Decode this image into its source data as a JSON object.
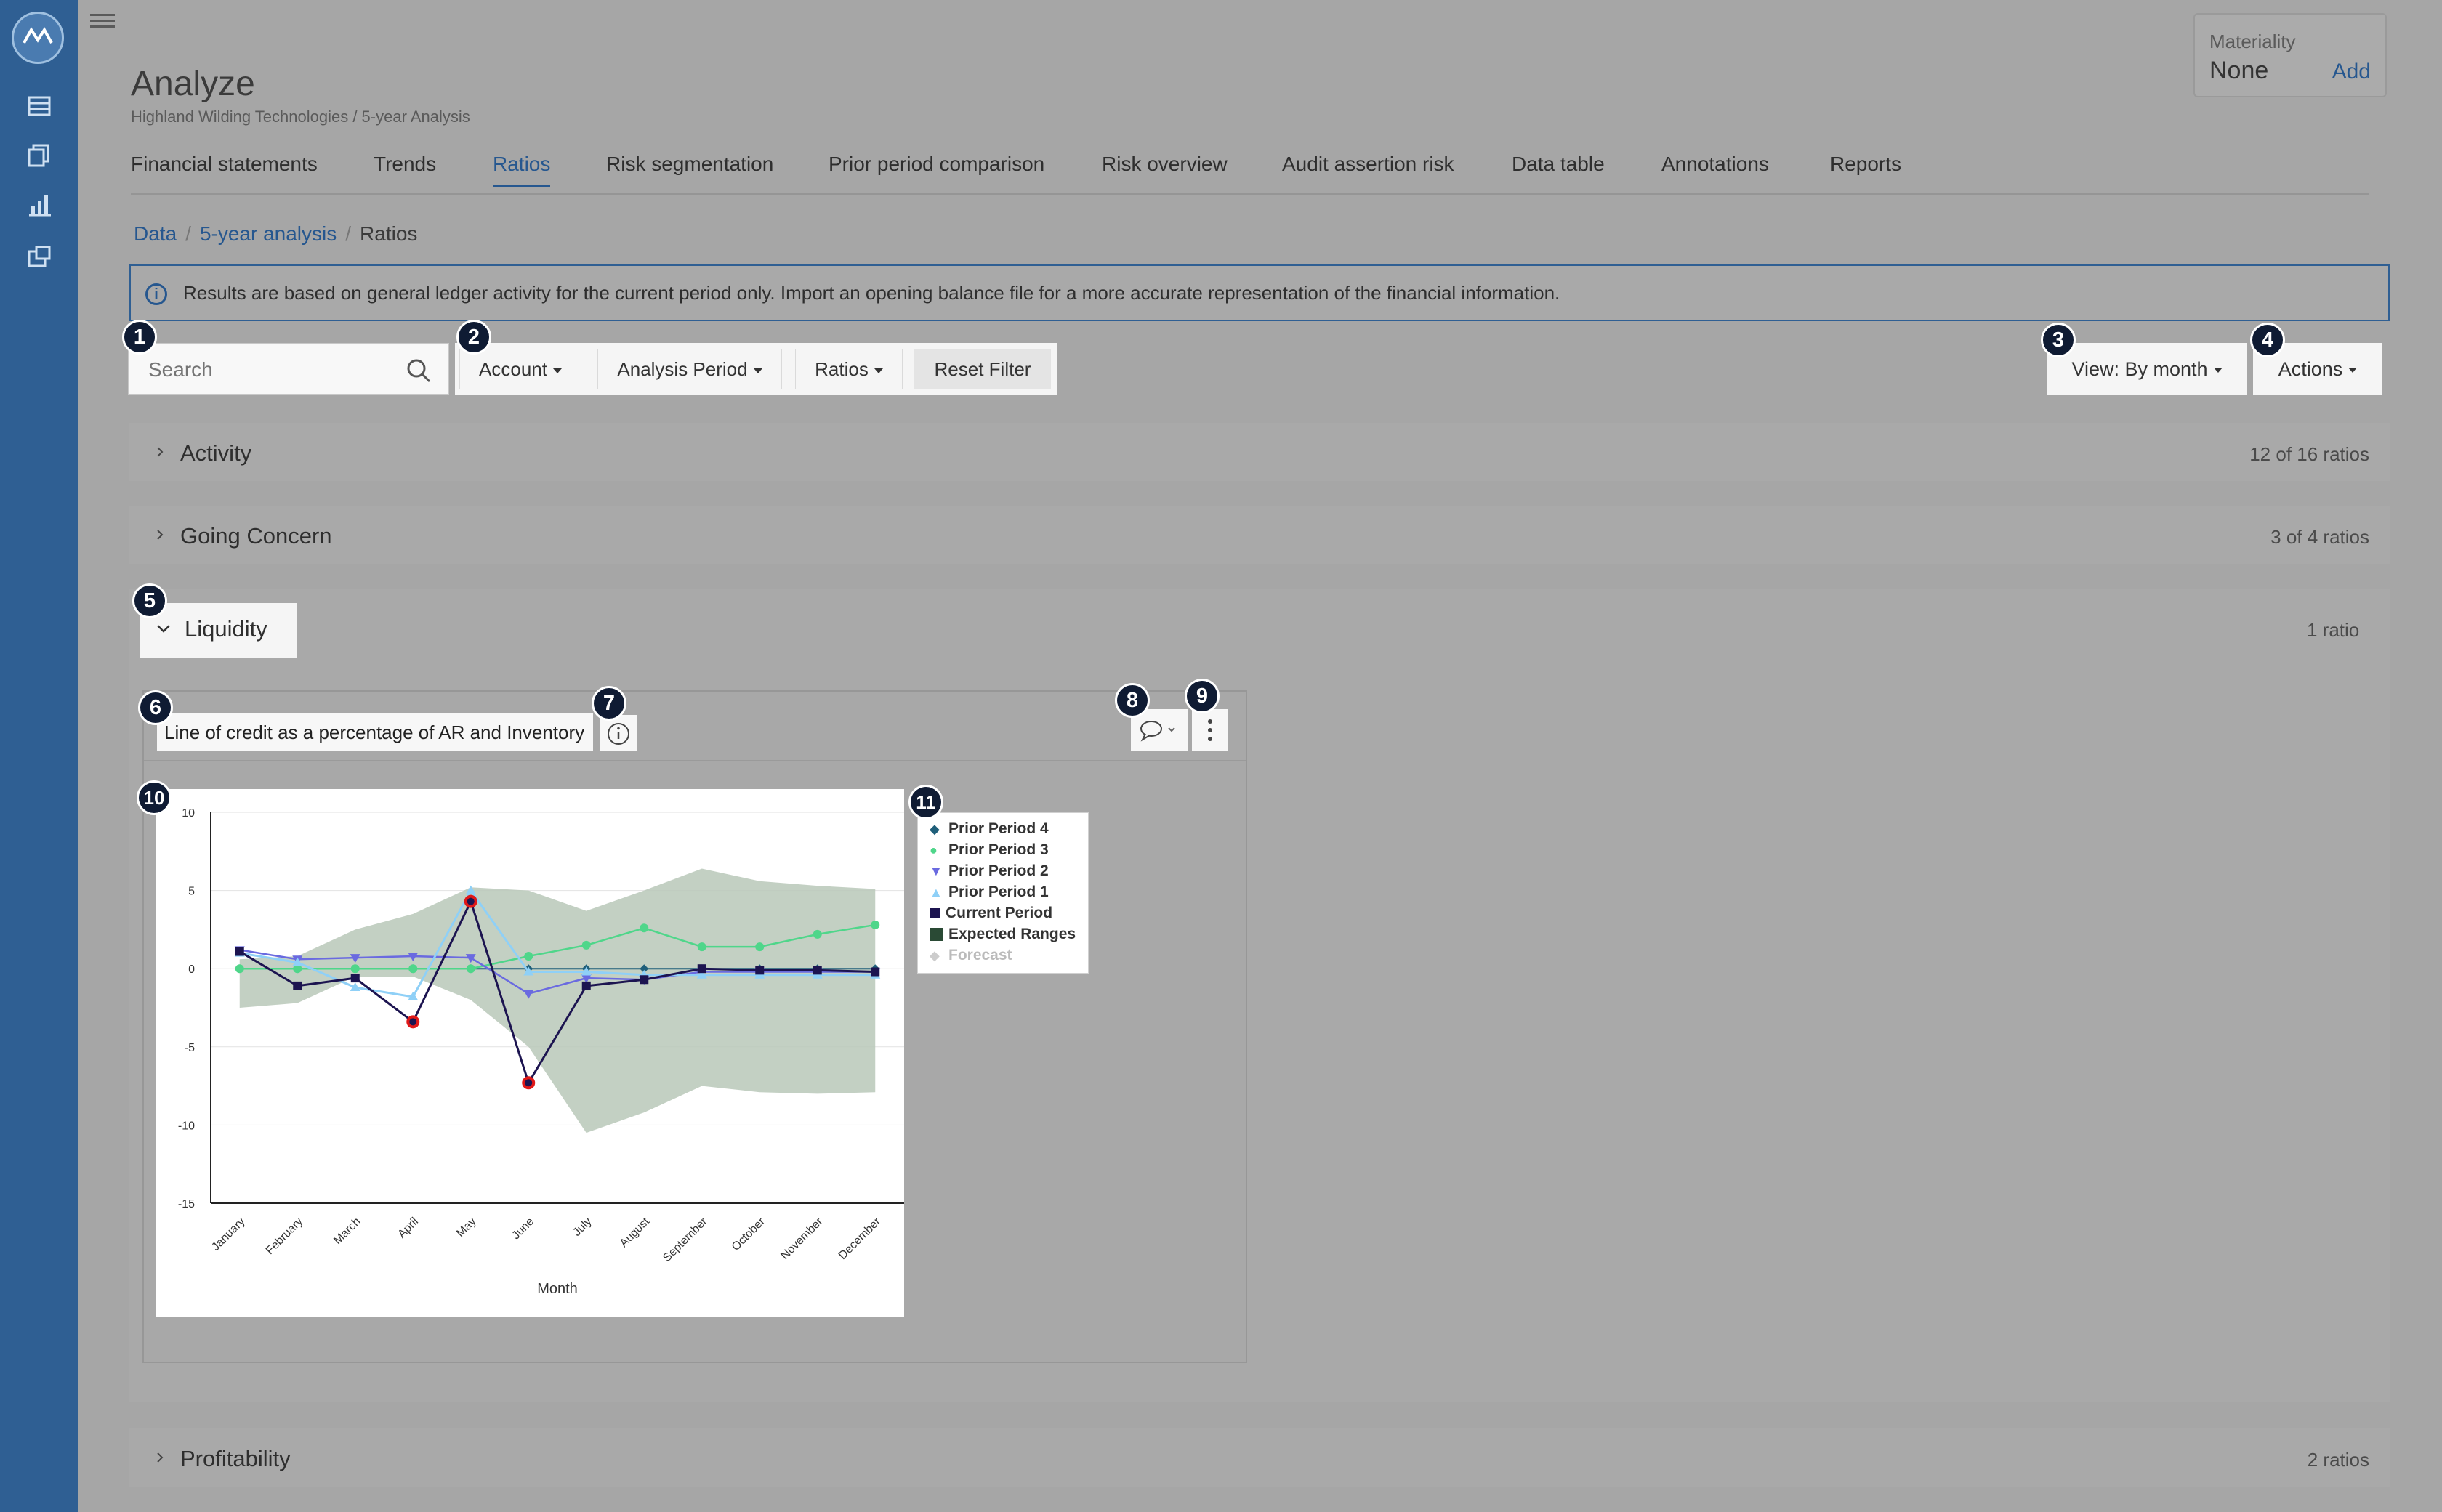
{
  "app": {
    "title": "Analyze",
    "subtitle": "Highland Wilding Technologies / 5-year Analysis",
    "materiality": {
      "label": "Materiality",
      "value": "None",
      "action": "Add"
    }
  },
  "tabs": [
    {
      "label": "Financial statements"
    },
    {
      "label": "Trends"
    },
    {
      "label": "Ratios",
      "active": true
    },
    {
      "label": "Risk segmentation"
    },
    {
      "label": "Prior period comparison"
    },
    {
      "label": "Risk overview"
    },
    {
      "label": "Audit assertion risk"
    },
    {
      "label": "Data table"
    },
    {
      "label": "Annotations"
    },
    {
      "label": "Reports"
    }
  ],
  "breadcrumb": {
    "items": [
      "Data",
      "5-year analysis",
      "Ratios"
    ]
  },
  "banner": {
    "text": "Results are based on general ledger activity for the current period only. Import an opening balance file for a more accurate representation of the financial information."
  },
  "toolbar": {
    "search_placeholder": "Search",
    "filters": [
      "Account",
      "Analysis Period",
      "Ratios"
    ],
    "reset": "Reset Filter",
    "view": "View: By month",
    "actions": "Actions"
  },
  "sections": {
    "activity": {
      "name": "Activity",
      "count": "12 of 16 ratios"
    },
    "going_concern": {
      "name": "Going Concern",
      "count": "3 of 4 ratios"
    },
    "liquidity": {
      "name": "Liquidity",
      "count": "1 ratio"
    },
    "profitability": {
      "name": "Profitability",
      "count": "2 ratios"
    }
  },
  "card": {
    "title": "Line of credit as a percentage of AR and Inventory"
  },
  "badges": [
    "1",
    "2",
    "3",
    "4",
    "5",
    "6",
    "7",
    "8",
    "9",
    "10",
    "11"
  ],
  "colors": {
    "rail": "#2f5f93",
    "accent": "#26578f",
    "prior4": "#1f5f7a",
    "prior3": "#4fd68a",
    "prior2": "#6a6ae0",
    "prior1": "#8fd0f7",
    "current": "#1c1450",
    "expected": "#b8c8b8",
    "outlier": "#e01818"
  },
  "chart_data": {
    "type": "line",
    "xlabel": "Month",
    "ylabel": "",
    "ylim": [
      -15,
      10
    ],
    "yticks": [
      "10",
      "5",
      "0",
      "-5",
      "-10",
      "-15"
    ],
    "categories": [
      "January",
      "February",
      "March",
      "April",
      "May",
      "June",
      "July",
      "August",
      "September",
      "October",
      "November",
      "December"
    ],
    "series": [
      {
        "name": "Prior Period 4",
        "values": [
          0,
          0,
          0,
          0,
          0,
          0,
          0,
          0,
          0,
          0,
          0,
          0
        ]
      },
      {
        "name": "Prior Period 3",
        "values": [
          0,
          0,
          0,
          0,
          0,
          0.8,
          1.5,
          2.6,
          1.4,
          1.4,
          2.2,
          2.8
        ]
      },
      {
        "name": "Prior Period 2",
        "values": [
          1.2,
          0.6,
          0.7,
          0.8,
          0.7,
          -1.6,
          -0.6,
          -0.7,
          -0.2,
          -0.2,
          -0.2,
          -0.2
        ]
      },
      {
        "name": "Prior Period 1",
        "values": [
          1.0,
          0.4,
          -1.2,
          -1.8,
          5.0,
          -0.2,
          -0.2,
          -0.4,
          -0.4,
          -0.4,
          -0.4,
          -0.4
        ]
      },
      {
        "name": "Current Period",
        "values": [
          1.1,
          -1.1,
          -0.6,
          -3.4,
          4.3,
          -7.3,
          -1.1,
          -0.7,
          0.0,
          -0.1,
          -0.1,
          -0.2
        ]
      }
    ],
    "expected_range": {
      "name": "Expected Ranges",
      "upper": [
        0.6,
        0.8,
        2.5,
        3.5,
        5.2,
        5.0,
        3.7,
        5.0,
        6.4,
        5.6,
        5.3,
        5.1
      ],
      "lower": [
        -2.5,
        -2.2,
        -0.5,
        -0.5,
        -2.0,
        -5.0,
        -10.5,
        -9.2,
        -7.5,
        -7.9,
        -8.0,
        -7.9
      ]
    },
    "outliers": [
      {
        "month": "April",
        "value": -3.4
      },
      {
        "month": "May",
        "value": 4.3
      },
      {
        "month": "June",
        "value": -7.3
      }
    ],
    "legend": [
      "Prior Period 4",
      "Prior Period 3",
      "Prior Period 2",
      "Prior Period 1",
      "Current Period",
      "Expected Ranges",
      "Forecast"
    ],
    "legend_position": "right",
    "grid": true
  }
}
